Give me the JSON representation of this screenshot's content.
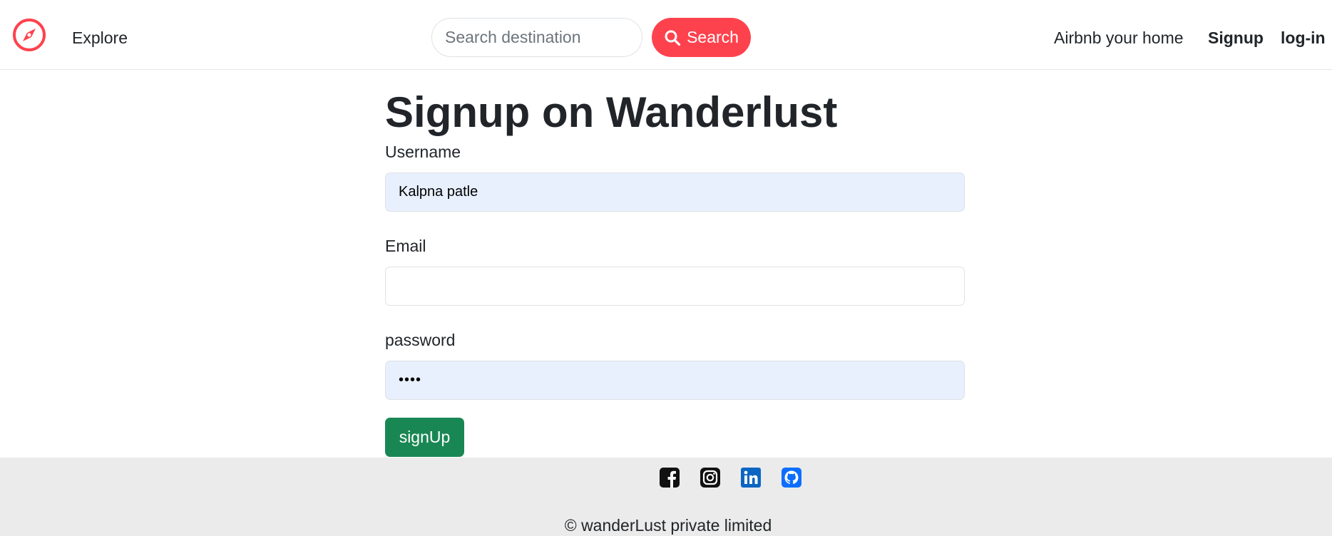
{
  "nav": {
    "logo_icon": "compass-icon",
    "explore": "Explore",
    "search_placeholder": "Search destination",
    "search_button": "Search",
    "host": "Airbnb your home",
    "signup": "Signup",
    "login": "log-in",
    "brand_color": "#fe424d"
  },
  "form": {
    "title": "Signup on Wanderlust",
    "username_label": "Username",
    "username_value": "Kalpna patle",
    "email_label": "Email",
    "email_value": "",
    "password_label": "password",
    "password_value": "abcd",
    "submit": "signUp",
    "submit_color": "#198754"
  },
  "footer": {
    "social": [
      "facebook-icon",
      "instagram-icon",
      "linkedin-icon",
      "github-icon"
    ],
    "copyright": "© wanderLust private limited"
  }
}
